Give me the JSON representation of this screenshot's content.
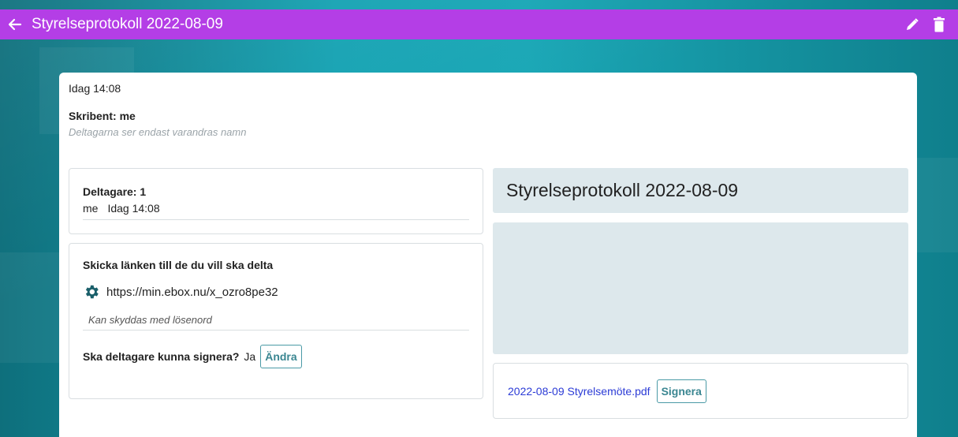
{
  "topbar": {
    "title": "Styrelseprotokoll 2022-08-09",
    "icons": {
      "back": "arrow-left-icon",
      "edit": "pencil-icon",
      "delete": "trash-icon"
    }
  },
  "meta": {
    "time": "Idag 14:08",
    "scribe": "Skribent: me",
    "scribe_note": "Deltagarna ser endast varandras namn"
  },
  "participants": {
    "title": "Deltagare: 1",
    "list": [
      {
        "name": "me",
        "time": "Idag 14:08"
      }
    ]
  },
  "share": {
    "title": "Skicka länken till de du vill ska delta",
    "url": "https://min.ebox.nu/x_ozro8pe32",
    "password_note": "Kan skyddas med lösenord",
    "sign_question": "Ska deltagare kunna signera?",
    "sign_answer": "Ja",
    "change_label": "Ändra",
    "icon": "gear-icon"
  },
  "document": {
    "title": "Styrelseprotokoll 2022-08-09",
    "file_name": "2022-08-09 Styrelsemöte.pdf",
    "sign_label": "Signera"
  },
  "colors": {
    "topbar": "#b43ee6",
    "background": "#0f7f8c",
    "doc_box": "#dde8ec",
    "accent": "#3a8691",
    "link": "#2b3bd6"
  }
}
